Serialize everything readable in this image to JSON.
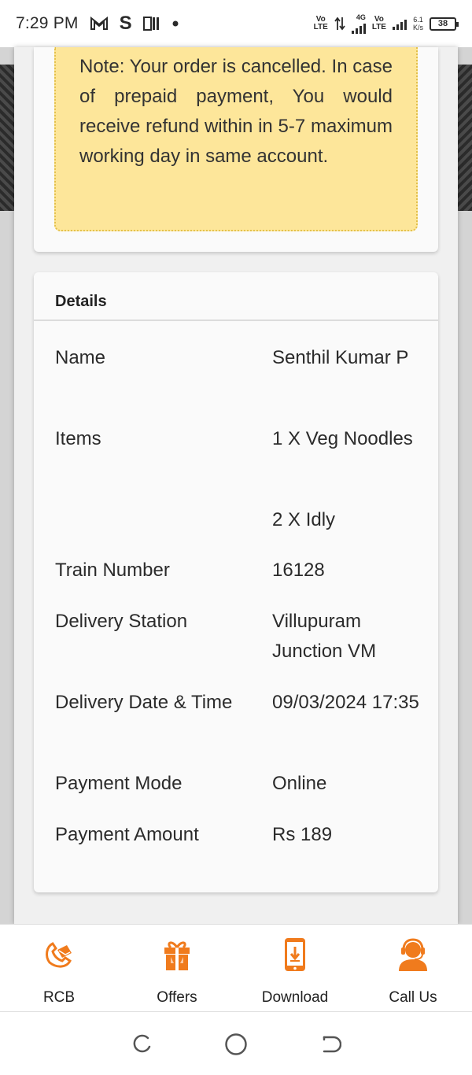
{
  "status_bar": {
    "time": "7:29 PM",
    "net1_top": "Vo",
    "net1_bottom": "LTE",
    "net_type": "4G",
    "net2_top": "Vo",
    "net2_bottom": "LTE",
    "speed_value": "6.1",
    "speed_unit": "K/s",
    "battery": "38",
    "icons": [
      "gmail-icon",
      "s-app-icon",
      "paytm-icon",
      "dot-icon",
      "signal-icon",
      "battery-icon"
    ]
  },
  "note": {
    "text": "Note: Your order is cancelled. In case of prepaid payment, You would receive refund within in 5-7 maximum working day in same account.",
    "background": "#fde69a"
  },
  "details": {
    "title": "Details",
    "rows": [
      {
        "label": "Name",
        "value": "Senthil Kumar P"
      },
      {
        "label": "Items",
        "value": "1 X Veg Noodles"
      },
      {
        "label": "",
        "value": "2 X Idly"
      },
      {
        "label": "Train Number",
        "value": "16128"
      },
      {
        "label": "Delivery Station",
        "value": "Villupuram Junction VM"
      },
      {
        "label": "Delivery Date & Time",
        "value": "09/03/2024 17:35"
      },
      {
        "label": "Payment Mode",
        "value": "Online"
      },
      {
        "label": "Payment Amount",
        "value": "Rs 189"
      }
    ]
  },
  "bottom_nav": {
    "accent": "#f07b1d",
    "tabs": [
      {
        "label": "RCB",
        "icon": "rcb-icon"
      },
      {
        "label": "Offers",
        "icon": "gift-icon"
      },
      {
        "label": "Download",
        "icon": "phone-download-icon"
      },
      {
        "label": "Call Us",
        "icon": "headset-agent-icon"
      }
    ]
  },
  "system_nav": {
    "icons": [
      "recent-apps-icon",
      "home-icon",
      "back-icon"
    ]
  }
}
